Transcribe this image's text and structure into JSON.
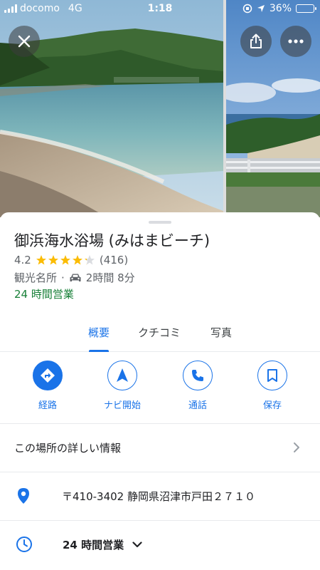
{
  "status_bar": {
    "carrier": "docomo",
    "network": "4G",
    "time": "1:18",
    "battery": "36%",
    "battery_level": 0.36
  },
  "place": {
    "name": "御浜海水浴場 (みはまビーチ)",
    "rating": "4.2",
    "rating_value": 4.2,
    "review_count": "(416)",
    "category": "観光名所",
    "separator": "·",
    "travel_time": "2時間 8分",
    "open_status": "24 時間営業"
  },
  "tabs": [
    {
      "label": "概要",
      "active": true
    },
    {
      "label": "クチコミ",
      "active": false
    },
    {
      "label": "写真",
      "active": false
    }
  ],
  "actions": [
    {
      "label": "経路",
      "icon": "directions-icon"
    },
    {
      "label": "ナビ開始",
      "icon": "navigation-arrow-icon"
    },
    {
      "label": "通話",
      "icon": "phone-icon"
    },
    {
      "label": "保存",
      "icon": "bookmark-icon"
    }
  ],
  "details": {
    "more_info": "この場所の詳しい情報",
    "address": "〒410-3402 静岡県沼津市戸田２７１０",
    "hours": "24 時間営業"
  },
  "colors": {
    "accent": "#1a73e8",
    "open_green": "#188038",
    "star": "#fbbc04"
  }
}
